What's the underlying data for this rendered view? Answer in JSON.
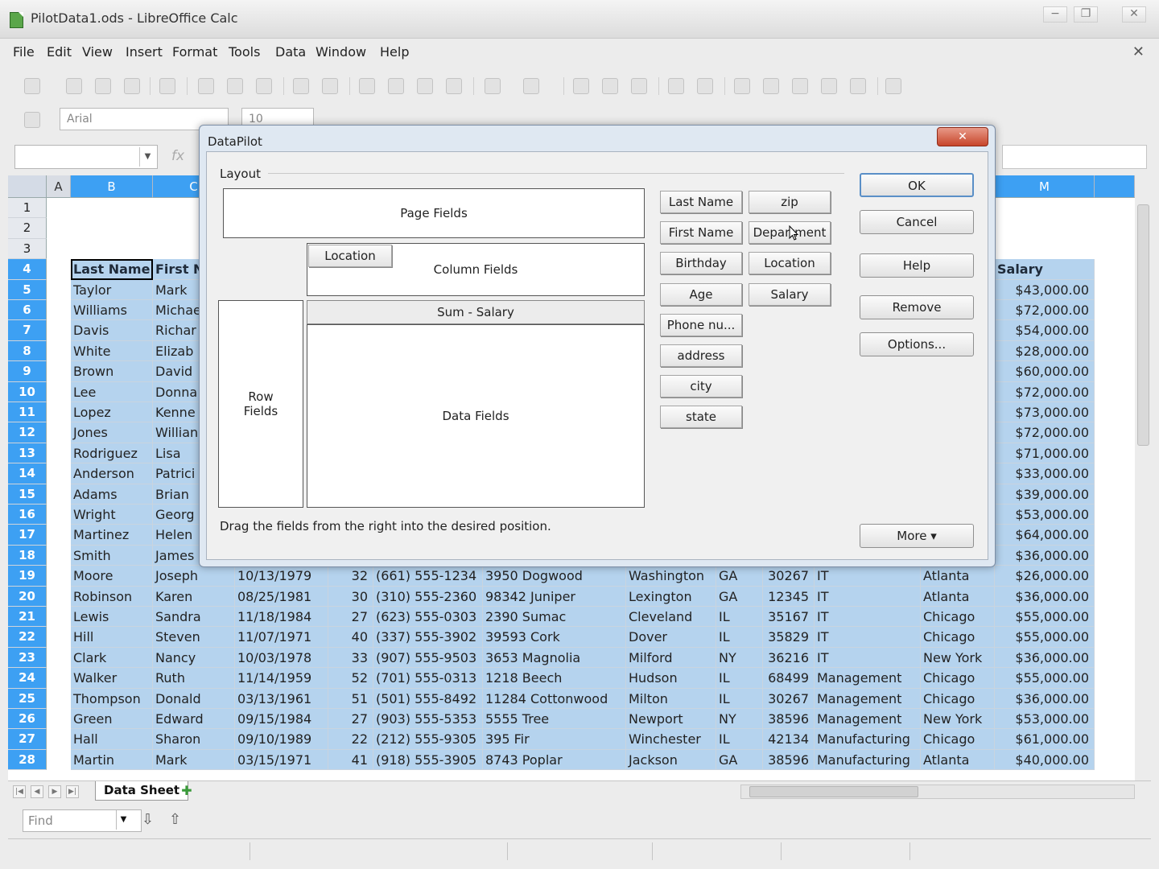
{
  "window": {
    "title": "PilotData1.ods - LibreOffice Calc",
    "minimize": "−",
    "restore": "❐",
    "close": "✕"
  },
  "menu": [
    "File",
    "Edit",
    "View",
    "Insert",
    "Format",
    "Tools",
    "Data",
    "Window",
    "Help"
  ],
  "doc_close": "✕",
  "font": {
    "name": "Arial",
    "size": "10"
  },
  "formula": {
    "fx": "fx"
  },
  "columns": [
    {
      "label": "A",
      "selected": false
    },
    {
      "label": "B",
      "selected": true
    },
    {
      "label": "C",
      "selected": true
    },
    {
      "label": "M",
      "selected": true
    }
  ],
  "rows": [
    {
      "n": "1",
      "sel": false
    },
    {
      "n": "2",
      "sel": false
    },
    {
      "n": "3",
      "sel": false
    },
    {
      "n": "4",
      "sel": true
    },
    {
      "n": "5",
      "sel": true
    },
    {
      "n": "6",
      "sel": true
    },
    {
      "n": "7",
      "sel": true
    },
    {
      "n": "8",
      "sel": true
    },
    {
      "n": "9",
      "sel": true
    },
    {
      "n": "10",
      "sel": true
    },
    {
      "n": "11",
      "sel": true
    },
    {
      "n": "12",
      "sel": true
    },
    {
      "n": "13",
      "sel": true
    },
    {
      "n": "14",
      "sel": true
    },
    {
      "n": "15",
      "sel": true
    },
    {
      "n": "16",
      "sel": true
    },
    {
      "n": "17",
      "sel": true
    },
    {
      "n": "18",
      "sel": true
    },
    {
      "n": "19",
      "sel": true
    },
    {
      "n": "20",
      "sel": true
    },
    {
      "n": "21",
      "sel": true
    },
    {
      "n": "22",
      "sel": true
    },
    {
      "n": "23",
      "sel": true
    },
    {
      "n": "24",
      "sel": true
    },
    {
      "n": "25",
      "sel": true
    },
    {
      "n": "26",
      "sel": true
    },
    {
      "n": "27",
      "sel": true
    },
    {
      "n": "28",
      "sel": true
    }
  ],
  "header_row": {
    "last": "Last Name",
    "first": "First N",
    "salary": "Salary"
  },
  "top_rows": [
    {
      "last": "Taylor",
      "first": "Mark",
      "salary": "$43,000.00"
    },
    {
      "last": "Williams",
      "first": "Michae",
      "salary": "$72,000.00"
    },
    {
      "last": "Davis",
      "first": "Richar",
      "salary": "$54,000.00"
    },
    {
      "last": "White",
      "first": "Elizab",
      "salary": "$28,000.00"
    },
    {
      "last": "Brown",
      "first": "David",
      "salary": "$60,000.00"
    },
    {
      "last": "Lee",
      "first": "Donna",
      "salary": "$72,000.00"
    },
    {
      "last": "Lopez",
      "first": "Kenne",
      "salary": "$73,000.00"
    },
    {
      "last": "Jones",
      "first": "Willian",
      "salary": "$72,000.00"
    },
    {
      "last": "Rodriguez",
      "first": "Lisa",
      "salary": "$71,000.00"
    },
    {
      "last": "Anderson",
      "first": "Patrici",
      "salary": "$33,000.00"
    },
    {
      "last": "Adams",
      "first": "Brian",
      "salary": "$39,000.00"
    },
    {
      "last": "Wright",
      "first": "Georg",
      "salary": "$53,000.00"
    },
    {
      "last": "Martinez",
      "first": "Helen",
      "salary": "$64,000.00"
    },
    {
      "last": "Smith",
      "first": "James",
      "salary": "$36,000.00"
    }
  ],
  "full_rows": [
    {
      "last": "Moore",
      "first": "Joseph",
      "bday": "10/13/1979",
      "age": "32",
      "phone": "(661) 555-1234",
      "addr": "3950 Dogwood",
      "city": "Washington",
      "st": "GA",
      "zip": "30267",
      "dept": "IT",
      "loc": "Atlanta",
      "salary": "$26,000.00"
    },
    {
      "last": "Robinson",
      "first": "Karen",
      "bday": "08/25/1981",
      "age": "30",
      "phone": "(310) 555-2360",
      "addr": "98342 Juniper",
      "city": "Lexington",
      "st": "GA",
      "zip": "12345",
      "dept": "IT",
      "loc": "Atlanta",
      "salary": "$36,000.00"
    },
    {
      "last": "Lewis",
      "first": "Sandra",
      "bday": "11/18/1984",
      "age": "27",
      "phone": "(623) 555-0303",
      "addr": "2390 Sumac",
      "city": "Cleveland",
      "st": "IL",
      "zip": "35167",
      "dept": "IT",
      "loc": "Chicago",
      "salary": "$55,000.00"
    },
    {
      "last": "Hill",
      "first": "Steven",
      "bday": "11/07/1971",
      "age": "40",
      "phone": "(337) 555-3902",
      "addr": "39593 Cork",
      "city": "Dover",
      "st": "IL",
      "zip": "35829",
      "dept": "IT",
      "loc": "Chicago",
      "salary": "$55,000.00"
    },
    {
      "last": "Clark",
      "first": "Nancy",
      "bday": "10/03/1978",
      "age": "33",
      "phone": "(907) 555-9503",
      "addr": "3653 Magnolia",
      "city": "Milford",
      "st": "NY",
      "zip": "36216",
      "dept": "IT",
      "loc": "New York",
      "salary": "$36,000.00"
    },
    {
      "last": "Walker",
      "first": "Ruth",
      "bday": "11/14/1959",
      "age": "52",
      "phone": "(701) 555-0313",
      "addr": "1218 Beech",
      "city": "Hudson",
      "st": "IL",
      "zip": "68499",
      "dept": "Management",
      "loc": "Chicago",
      "salary": "$55,000.00"
    },
    {
      "last": "Thompson",
      "first": "Donald",
      "bday": "03/13/1961",
      "age": "51",
      "phone": "(501) 555-8492",
      "addr": "11284 Cottonwood",
      "city": "Milton",
      "st": "IL",
      "zip": "30267",
      "dept": "Management",
      "loc": "Chicago",
      "salary": "$36,000.00"
    },
    {
      "last": "Green",
      "first": "Edward",
      "bday": "09/15/1984",
      "age": "27",
      "phone": "(903) 555-5353",
      "addr": "5555 Tree",
      "city": "Newport",
      "st": "NY",
      "zip": "38596",
      "dept": "Management",
      "loc": "New York",
      "salary": "$53,000.00"
    },
    {
      "last": "Hall",
      "first": "Sharon",
      "bday": "09/10/1989",
      "age": "22",
      "phone": "(212) 555-9305",
      "addr": "395 Fir",
      "city": "Winchester",
      "st": "IL",
      "zip": "42134",
      "dept": "Manufacturing",
      "loc": "Chicago",
      "salary": "$61,000.00"
    },
    {
      "last": "Martin",
      "first": "Mark",
      "bday": "03/15/1971",
      "age": "41",
      "phone": "(918) 555-3905",
      "addr": "8743 Poplar",
      "city": "Jackson",
      "st": "GA",
      "zip": "38596",
      "dept": "Manufacturing",
      "loc": "Atlanta",
      "salary": "$40,000.00"
    }
  ],
  "sheet_tab": "Data Sheet",
  "find_placeholder": "Find",
  "dialog": {
    "title": "DataPilot",
    "close": "✕",
    "layout_label": "Layout",
    "page_fields": "Page Fields",
    "column_fields": "Column Fields",
    "row_fields_1": "Row",
    "row_fields_2": "Fields",
    "data_fields": "Data Fields",
    "sum_label": "Sum - Salary",
    "column_chip": "Location",
    "hint": "Drag the fields from the right into the desired position.",
    "fields_col1": [
      "Last Name",
      "First Name",
      "Birthday",
      "Age",
      "Phone nu...",
      "address",
      "city",
      "state"
    ],
    "fields_col2": [
      "zip",
      "Department",
      "Location",
      "Salary"
    ],
    "buttons": {
      "ok": "OK",
      "cancel": "Cancel",
      "help": "Help",
      "remove": "Remove",
      "options": "Options...",
      "more": "More ▾"
    }
  }
}
